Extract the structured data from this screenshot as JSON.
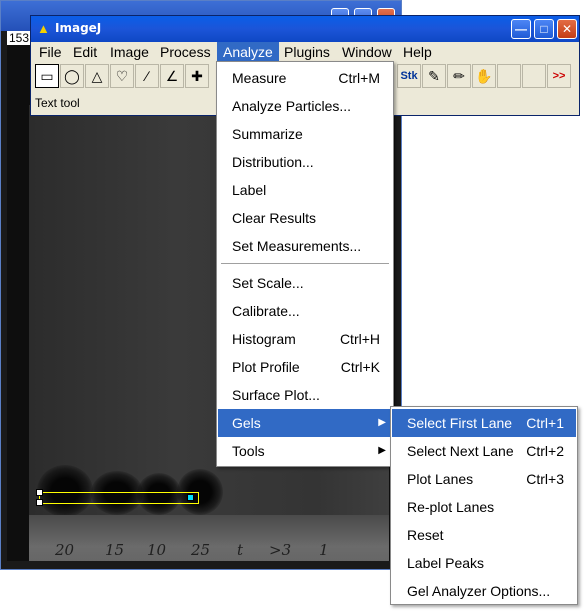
{
  "image_window": {
    "info_text": "153",
    "gel_labels": [
      "20",
      "15",
      "10",
      "25",
      "t",
      ">3",
      "1"
    ]
  },
  "app": {
    "title": "ImageJ",
    "status_text": "Text tool"
  },
  "menubar": {
    "items": [
      "File",
      "Edit",
      "Image",
      "Process",
      "Analyze",
      "Plugins",
      "Window",
      "Help"
    ],
    "active": "Analyze"
  },
  "toolbar": {
    "tools": [
      "rectangle-tool",
      "oval-tool",
      "polygon-tool",
      "freehand-tool",
      "line-tool",
      "angle-tool",
      "point-tool",
      "stk-tool",
      "pencil-tool",
      "brush-tool",
      "flood-fill-tool",
      "more-tools"
    ],
    "stk_label": "Stk",
    "more_label": ">>"
  },
  "analyze_menu": {
    "items": [
      {
        "label": "Measure",
        "shortcut": "Ctrl+M"
      },
      {
        "label": "Analyze Particles...",
        "shortcut": ""
      },
      {
        "label": "Summarize",
        "shortcut": ""
      },
      {
        "label": "Distribution...",
        "shortcut": ""
      },
      {
        "label": "Label",
        "shortcut": ""
      },
      {
        "label": "Clear Results",
        "shortcut": ""
      },
      {
        "label": "Set Measurements...",
        "shortcut": ""
      },
      {
        "label": "Set Scale...",
        "shortcut": ""
      },
      {
        "label": "Calibrate...",
        "shortcut": ""
      },
      {
        "label": "Histogram",
        "shortcut": "Ctrl+H"
      },
      {
        "label": "Plot Profile",
        "shortcut": "Ctrl+K"
      },
      {
        "label": "Surface Plot...",
        "shortcut": ""
      },
      {
        "label": "Gels",
        "shortcut": ""
      },
      {
        "label": "Tools",
        "shortcut": ""
      }
    ],
    "highlighted": "Gels"
  },
  "gels_menu": {
    "items": [
      {
        "label": "Select First Lane",
        "shortcut": "Ctrl+1"
      },
      {
        "label": "Select Next Lane",
        "shortcut": "Ctrl+2"
      },
      {
        "label": "Plot Lanes",
        "shortcut": "Ctrl+3"
      },
      {
        "label": "Re-plot Lanes",
        "shortcut": ""
      },
      {
        "label": "Reset",
        "shortcut": ""
      },
      {
        "label": "Label Peaks",
        "shortcut": ""
      },
      {
        "label": "Gel Analyzer Options...",
        "shortcut": ""
      }
    ],
    "highlighted": "Select First Lane"
  },
  "colors": {
    "title_bar": "#0a5ee8",
    "menu_highlight": "#316ac5",
    "selection_line": "#ffff00"
  }
}
